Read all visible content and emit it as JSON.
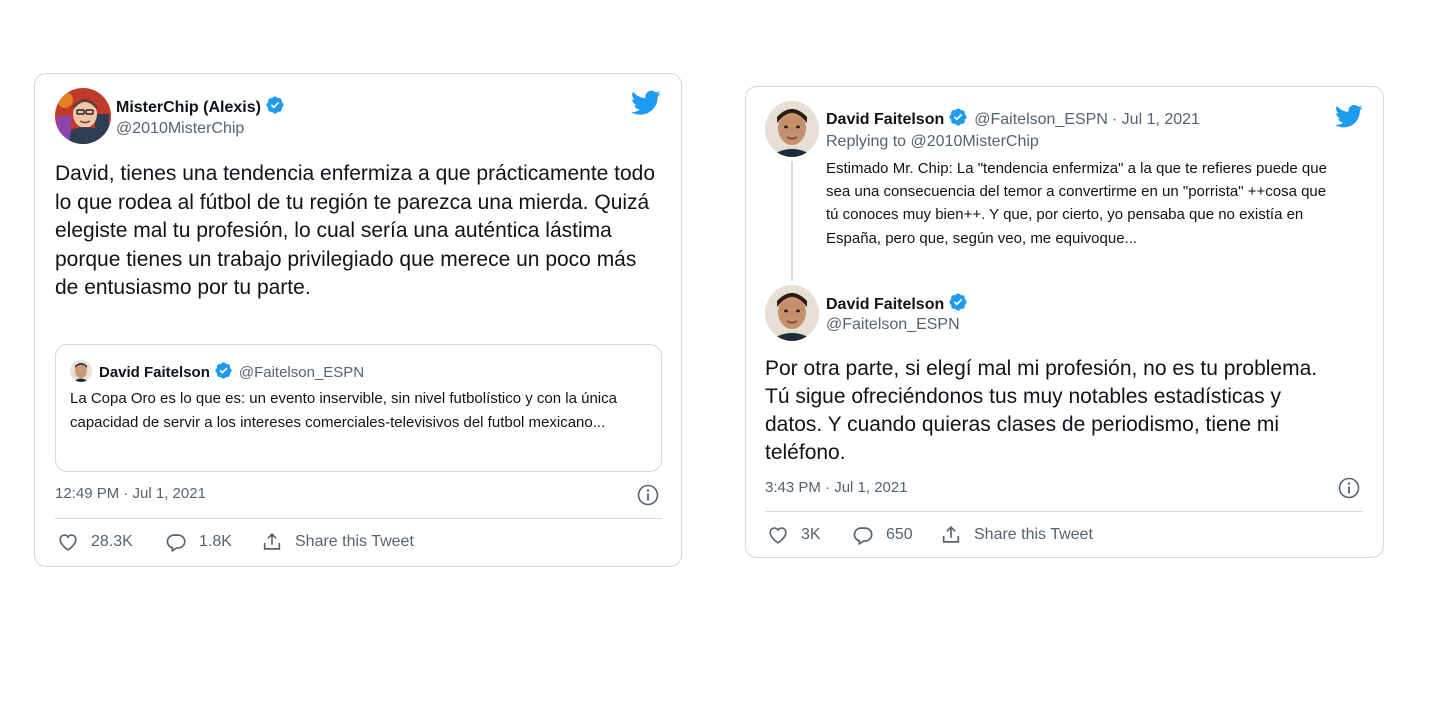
{
  "tweet1": {
    "author_name": "MisterChip (Alexis)",
    "author_handle": "@2010MisterChip",
    "text": "David, tienes una tendencia enfermiza a que prácticamente todo lo que rodea al fútbol de tu región te parezca una mierda. Quizá elegiste mal tu profesión, lo cual sería una auténtica lástima porque tienes un trabajo privilegiado que merece un poco más de entusiasmo por tu parte.",
    "quote": {
      "author_name": "David Faitelson",
      "author_handle": "@Faitelson_ESPN",
      "text": "La Copa Oro es lo que es: un evento inservible,  sin nivel futbolístico y con la única capacidad de servir a los intereses comerciales-televisivos del futbol mexicano..."
    },
    "timestamp": "12:49 PM · Jul 1, 2021",
    "likes": "28.3K",
    "replies": "1.8K",
    "share_label": "Share this Tweet"
  },
  "tweet2": {
    "parent": {
      "author_name": "David Faitelson",
      "author_handle": "@Faitelson_ESPN",
      "date": "· Jul 1, 2021",
      "replying_prefix": "Replying to",
      "replying_to": "@2010MisterChip",
      "text": "Estimado Mr. Chip: La \"tendencia enfermiza\" a la que te refieres puede que sea una consecuencia del temor a convertirme en un \"porrista\" ++cosa que tú conoces muy bien++. Y que, por cierto,  yo pensaba que no existía en España, pero que, según veo, me equivoque..."
    },
    "author_name": "David Faitelson",
    "author_handle": "@Faitelson_ESPN",
    "text": "Por otra parte, si elegí mal mi profesión, no es tu problema. Tú sigue ofreciéndonos tus muy notables estadísticas y datos. Y cuando quieras clases de periodismo, tiene mi teléfono.",
    "timestamp": "3:43 PM · Jul 1, 2021",
    "likes": "3K",
    "replies": "650",
    "share_label": "Share this Tweet"
  },
  "colors": {
    "twitter_blue": "#1d9bf0",
    "text_primary": "#0f1419",
    "text_secondary": "#536471",
    "border": "#cfd9de"
  },
  "icons": [
    "twitter-bird-icon",
    "verified-badge-icon",
    "heart-icon",
    "reply-bubble-icon",
    "share-icon",
    "info-icon"
  ]
}
